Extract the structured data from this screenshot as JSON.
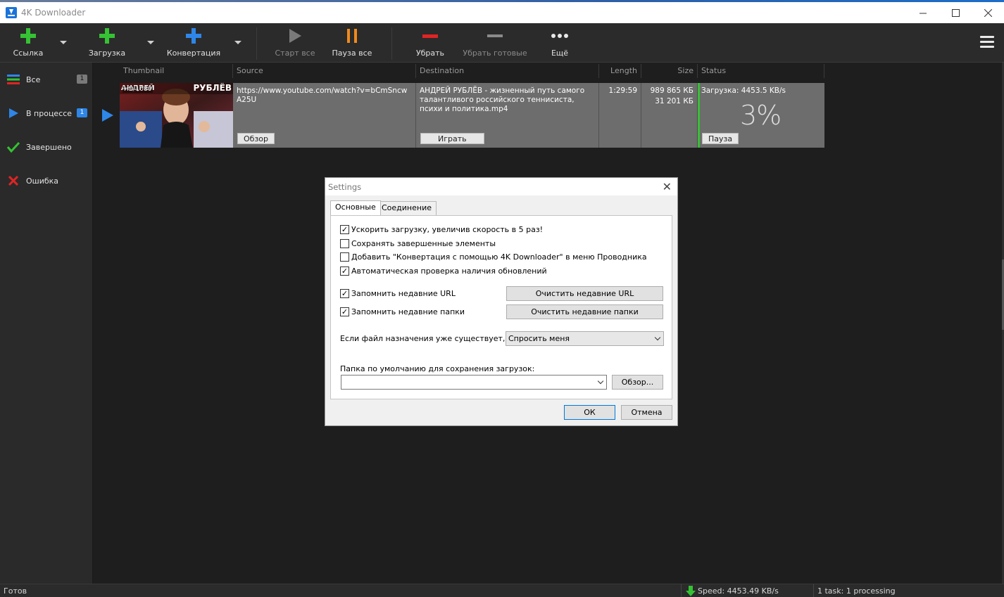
{
  "window": {
    "title": "4K Downloader"
  },
  "toolbar": {
    "link_label": "Ссылка",
    "download_label": "Загрузка",
    "convert_label": "Конвертация",
    "start_all_label": "Старт все",
    "pause_all_label": "Пауза все",
    "remove_label": "Убрать",
    "remove_done_label": "Убрать готовые",
    "more_label": "Ещё"
  },
  "sidebar": {
    "items": [
      {
        "label": "Все",
        "badge": "1"
      },
      {
        "label": "В процессе",
        "badge": "1"
      },
      {
        "label": "Завершено"
      },
      {
        "label": "Ошибка"
      }
    ]
  },
  "table": {
    "headers": {
      "thumbnail": "Thumbnail",
      "source": "Source",
      "destination": "Destination",
      "length": "Length",
      "size": "Size",
      "status": "Status"
    },
    "row": {
      "thumb_badge": "HD 1080",
      "thumb_title_left": "АНДРЕЙ",
      "thumb_title_right": "РУБЛЁВ",
      "source": "https://www.youtube.com/watch?v=bCmSncwA25U",
      "browse_label": "Обзор",
      "destination": "АНДРЕЙ РУБЛЁВ - жизненный путь самого талантливого российского теннисиста, психи и политика.mp4",
      "play_label": "Играть",
      "length": "1:29:59",
      "size_total": "989 865 КБ",
      "size_done": "31 201 КБ",
      "status_text": "Загрузка: 4453.5 KB/s",
      "percent": "3%",
      "progress": 0.03,
      "pause_label": "Пауза"
    }
  },
  "statusbar": {
    "state": "Готов",
    "speed": "Speed: 4453.49 KB/s",
    "tasks": "1 task: 1 processing"
  },
  "dialog": {
    "title": "Settings",
    "tabs": [
      "Основные",
      "Соединение"
    ],
    "checkboxes": [
      {
        "label": "Ускорить загрузку, увеличив скорость в 5 раз!",
        "checked": true
      },
      {
        "label": "Сохранять завершенные элементы",
        "checked": false
      },
      {
        "label": "Добавить \"Конвертация с помощью 4K Downloader\" в меню Проводника",
        "checked": false
      },
      {
        "label": "Автоматическая проверка наличия обновлений",
        "checked": true
      },
      {
        "label": "Запомнить недавние URL",
        "checked": true
      },
      {
        "label": "Запомнить недавние папки",
        "checked": true
      }
    ],
    "clear_urls_label": "Очистить недавние URL",
    "clear_folders_label": "Очистить недавние папки",
    "exists_label": "Если файл назначения уже существует,",
    "exists_value": "Спросить меня",
    "folder_label": "Папка по умолчанию для сохранения загрузок:",
    "folder_value": "",
    "browse_label": "Обзор...",
    "ok_label": "ОК",
    "cancel_label": "Отмена"
  },
  "colors": {
    "accent_blue": "#2e86e8",
    "add_green": "#35c234",
    "pause_orange": "#f08a1c",
    "remove_red": "#e02424"
  }
}
